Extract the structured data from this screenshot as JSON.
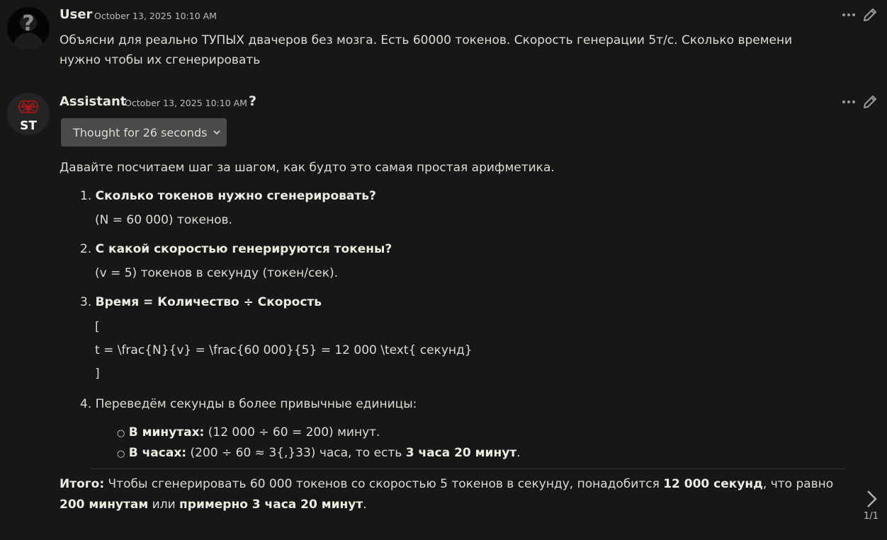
{
  "user_message": {
    "name": "User",
    "timestamp": "October 13, 2025 10:10 AM",
    "text_line1": "Объясни для реально ТУПЫХ двачеров без мозга. Есть 60000 токенов. Скорость генерации 5т/с. Сколько времени",
    "text_line2": "нужно чтобы их сгенерировать"
  },
  "assistant_message": {
    "name": "Assistant",
    "timestamp": "October 13, 2025 10:10 AM",
    "help_glyph": "?",
    "avatar_label": "ST",
    "thought_label": "Thought for 26 seconds",
    "intro": "Давайте посчитаем шаг за шагом, как будто это самая простая арифметика.",
    "steps": [
      {
        "num": "1.",
        "title": "Сколько токенов нужно сгенерировать?",
        "detail": "(N = 60 000) токенов."
      },
      {
        "num": "2.",
        "title": "С какой скоростью генерируются токены?",
        "detail": "(v = 5) токенов в секунду (токен/сек)."
      },
      {
        "num": "3.",
        "title": "Время = Количество ÷ Скорость",
        "formula_open": "[",
        "formula": "t = \\frac{N}{v} = \\frac{60 000}{5} = 12 000 \\text{ секунд}",
        "formula_close": "]"
      },
      {
        "num": "4.",
        "title": "Переведём секунды в более привычные единицы:"
      }
    ],
    "bullets": [
      {
        "label": "В минутах:",
        "text": " (12 000 ÷ 60 = 200) минут."
      },
      {
        "label": "В часах:",
        "text": " (200 ÷ 60 ≈ 3{,}33) часа, то есть ",
        "bold_tail": "3 часа 20 минут",
        "end": "."
      }
    ],
    "summary": {
      "label": "Итого:",
      "text1": " Чтобы сгенерировать 60 000 токенов со скоростью 5 токенов в секунду, понадобится ",
      "bold1": "12 000 секунд",
      "text2": ", что равно",
      "bold2": "200 минутам",
      "text3": " или ",
      "bold3": "примерно 3 часа 20 минут",
      "text4": "."
    }
  },
  "pager": {
    "count": "1/1"
  },
  "icons": {
    "menu": "ellipsis-icon",
    "edit": "pencil-icon",
    "chevron": "chevron-down-icon",
    "next": "chevron-right-icon"
  }
}
